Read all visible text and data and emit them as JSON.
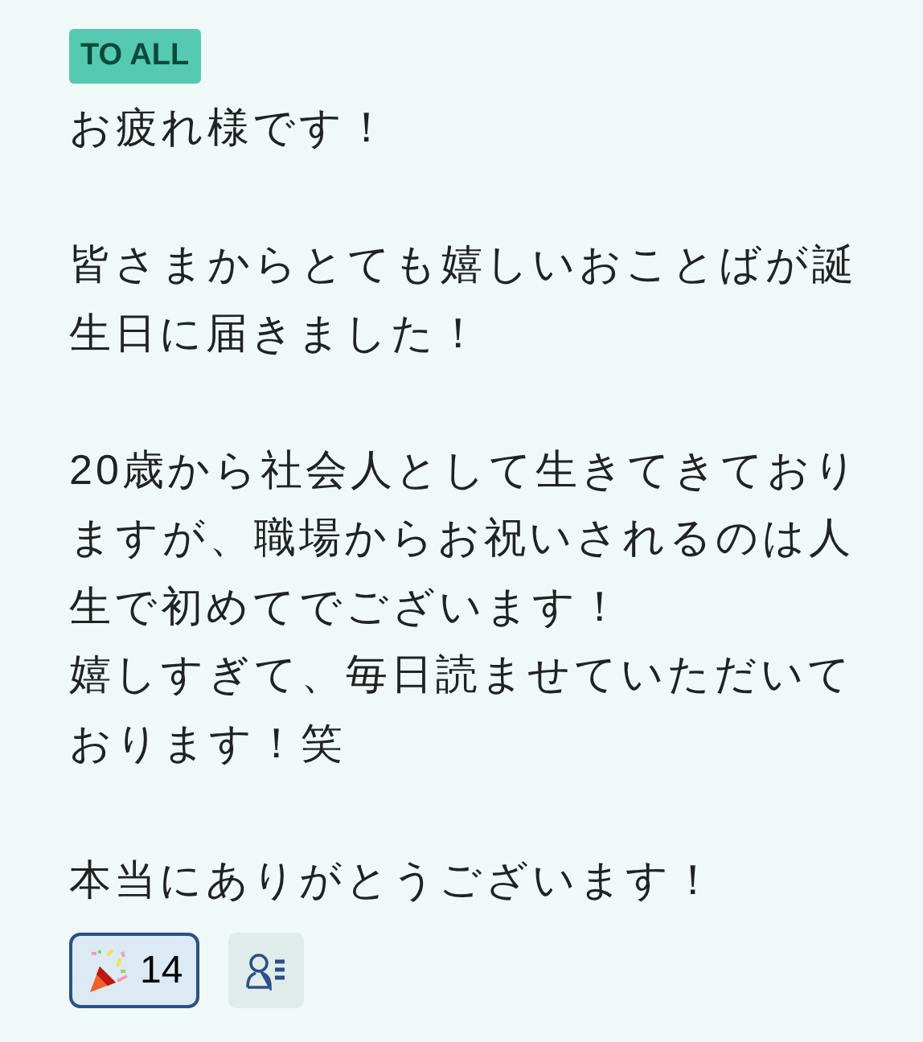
{
  "badge": "TO ALL",
  "paragraphs": [
    [
      "お疲れ様です！"
    ],
    [
      "皆さまからとても嬉しいおことばが誕生日に届きました！"
    ],
    [
      "20歳から社会人として生きてきておりますが、職場からお祝いされるのは人生で初めてでございます！",
      "嬉しすぎて、毎日読ませていただいております！笑"
    ],
    [
      "本当にありがとうございます！"
    ]
  ],
  "reactions": [
    {
      "count": "14",
      "selected": true
    }
  ]
}
